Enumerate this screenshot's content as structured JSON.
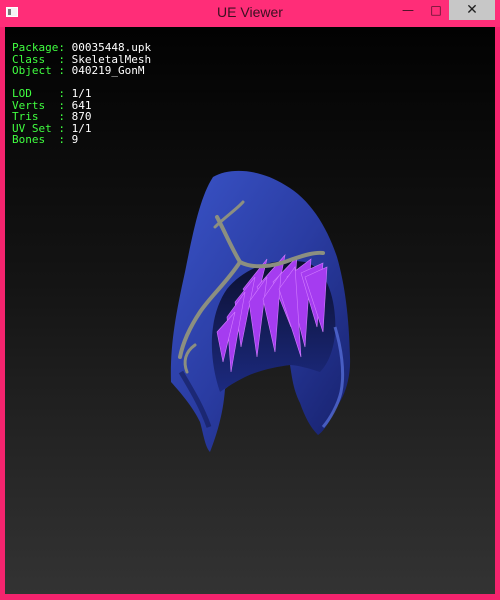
{
  "window": {
    "title": "UE Viewer",
    "buttons": {
      "minimize": "—",
      "maximize": "□",
      "close": "✕"
    }
  },
  "info": {
    "package": {
      "key": "Package: ",
      "value": "00035448.upk"
    },
    "class": {
      "key": "Class  : ",
      "value": "SkeletalMesh"
    },
    "object": {
      "key": "Object : ",
      "value": "040219_GonM"
    },
    "lod": {
      "key": "LOD    : ",
      "value": "1/1"
    },
    "verts": {
      "key": "Verts  : ",
      "value": "641"
    },
    "tris": {
      "key": "Tris   : ",
      "value": "870"
    },
    "uvset": {
      "key": "UV Set : ",
      "value": "1/1"
    },
    "bones": {
      "key": "Bones  : ",
      "value": "9"
    }
  },
  "colors": {
    "frame": "#ff2d78",
    "label": "#40ff40",
    "value": "#ffffff",
    "hood": "#2b3fa8",
    "hair": "#a53cf0"
  },
  "mesh": {
    "icon": "hood-mesh"
  }
}
